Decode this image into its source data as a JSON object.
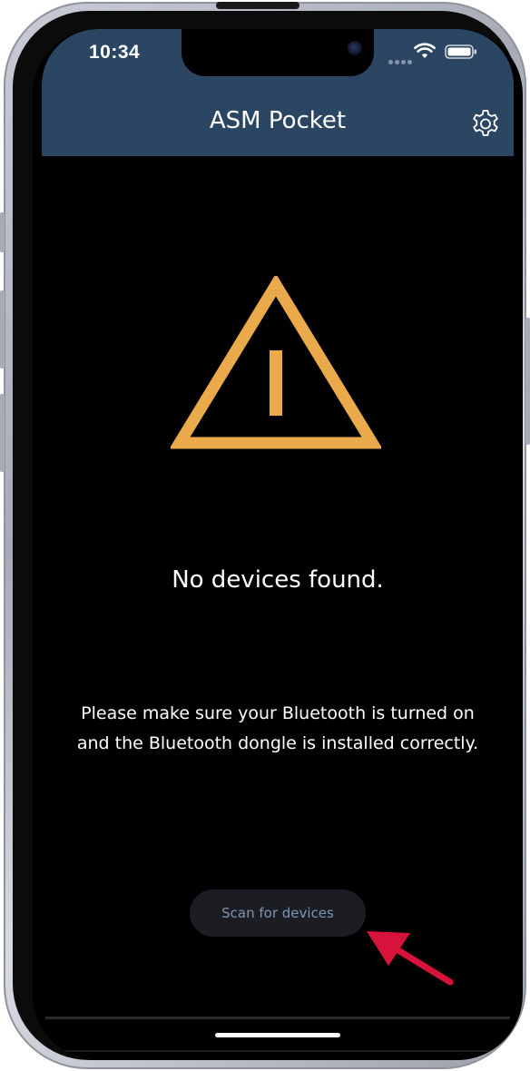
{
  "status_bar": {
    "time": "10:34"
  },
  "header": {
    "title": "ASM Pocket",
    "settings_icon": "gear-icon"
  },
  "main": {
    "warning_icon": "warning-triangle-icon",
    "headline": "No devices found.",
    "message": "Please make sure your Bluetooth is turned on and the Bluetooth dongle is installed correctly.",
    "scan_button_label": "Scan for devices"
  },
  "colors": {
    "header_background": "#2b4663",
    "warning_accent": "#eaaa4c",
    "screen_background": "#000000",
    "button_background": "#1b1d22",
    "button_text": "#7f96b2",
    "annotation_arrow": "#d8133b"
  }
}
